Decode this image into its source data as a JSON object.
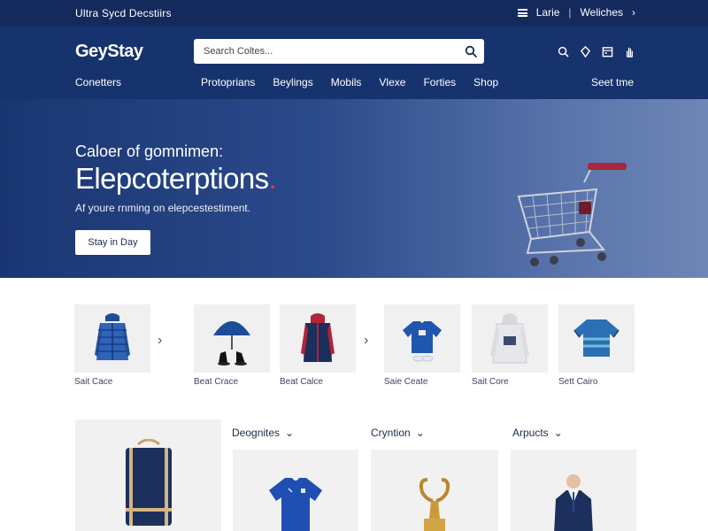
{
  "topbar": {
    "brand_line": "Ultra Sycd  Decstiirs",
    "link_1": "Larie",
    "separator": "|",
    "link_2": "Weliches",
    "chevron": "›"
  },
  "header": {
    "logo": "GeyStay",
    "search_placeholder": "Search Coltes...",
    "icons": [
      "search-icon",
      "location-icon",
      "calendar-icon",
      "hand-icon"
    ]
  },
  "nav": {
    "left": "Conetters",
    "items": [
      "Protoprians",
      "Beylings",
      "Mobils",
      "Vlexe",
      "Forties",
      "Shop"
    ],
    "right": "Seet tme"
  },
  "hero": {
    "subtitle": "Caloer of gomnimen:",
    "title": "Elepcoterptions",
    "title_dot": ".",
    "description": "Af youre rnming on elepcestestiment.",
    "cta": "Stay in Day"
  },
  "products": [
    {
      "caption": "Sait Cace",
      "icon": "jacket-icon"
    },
    {
      "caption": "Beat Crace",
      "icon": "umbrella-icon"
    },
    {
      "caption": "Beat Calce",
      "icon": "coat-icon"
    },
    {
      "caption": "Saie Ceate",
      "icon": "tshirt-icon"
    },
    {
      "caption": "Sait Core",
      "icon": "hoodie-icon"
    },
    {
      "caption": "Sett Cairo",
      "icon": "sweater-icon"
    }
  ],
  "arrows": [
    "›",
    "›"
  ],
  "columns": [
    {
      "label": "Deognites",
      "chevron": "⌄"
    },
    {
      "label": "Cryntion",
      "chevron": "⌄"
    },
    {
      "label": "Arpucts",
      "chevron": "⌄"
    }
  ],
  "colors": {
    "topbar": "#142a5c",
    "header": "#17336d",
    "accent_dot": "#e23a52",
    "tile": "#f0f0f0"
  }
}
